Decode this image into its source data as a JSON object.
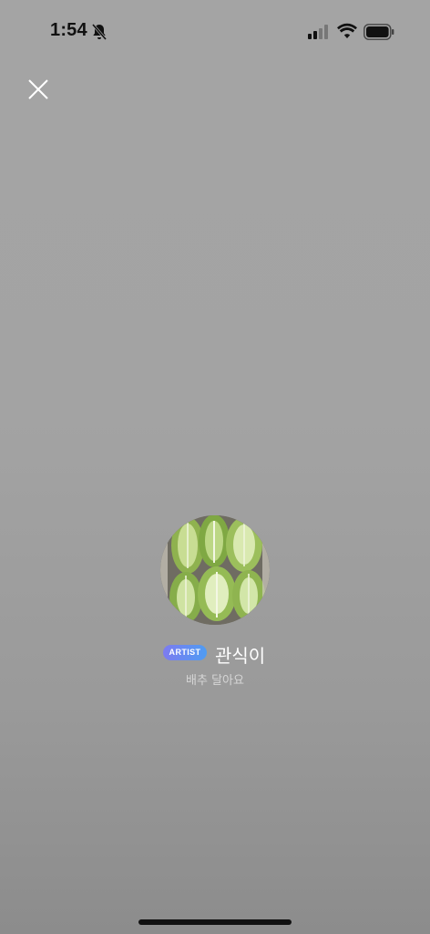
{
  "status_bar": {
    "time": "1:54",
    "icons": [
      "bell-slash-icon",
      "cellular-signal-icon",
      "wifi-icon",
      "battery-icon"
    ]
  },
  "header": {
    "close_icon": "close-icon"
  },
  "profile": {
    "badge": "ARTIST",
    "name": "관식이",
    "status_message": "배추 달아요",
    "avatar": "cabbage-photo"
  },
  "colors": {
    "background": "#a3a3a3",
    "badge_start": "#7d7bf0",
    "badge_end": "#4f9cf2",
    "name": "#ffffff",
    "status_message": "#d6d6d6"
  }
}
